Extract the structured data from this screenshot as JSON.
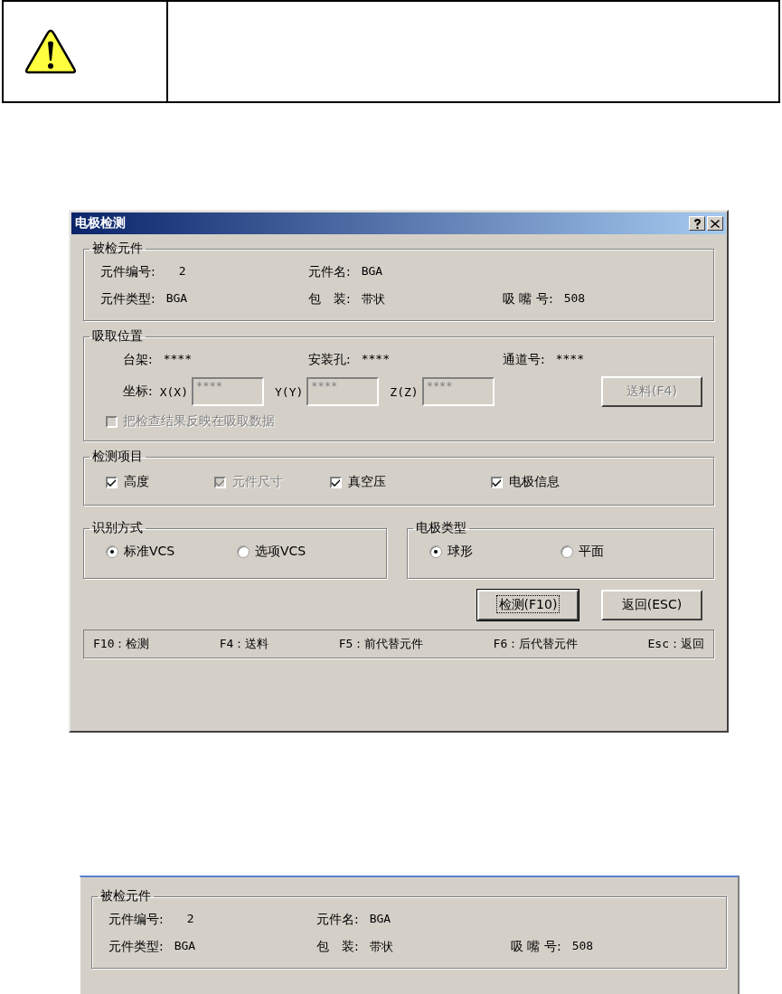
{
  "dialog": {
    "title": "电极检测",
    "part_group": {
      "title": "被检元件",
      "rows": [
        [
          {
            "label": "元件编号:",
            "value": "2"
          },
          {
            "label": "元件名:",
            "value": "BGA"
          }
        ],
        [
          {
            "label": "元件类型:",
            "value": "BGA"
          },
          {
            "label": "包　装:",
            "value": "带状"
          },
          {
            "label": "吸 嘴 号:",
            "value": "508"
          }
        ]
      ]
    },
    "pickup_group": {
      "title": "吸取位置",
      "info": [
        {
          "label": "台架:",
          "value": "****"
        },
        {
          "label": "安装孔:",
          "value": "****"
        },
        {
          "label": "通道号:",
          "value": "****"
        }
      ],
      "coord_label": "坐标:",
      "coords": [
        {
          "label": "X(X)",
          "value": "****",
          "disabled": true
        },
        {
          "label": "Y(Y)",
          "value": "****",
          "disabled": true
        },
        {
          "label": "Z(Z)",
          "value": "****",
          "disabled": true
        }
      ],
      "feed_button": {
        "label": "送料(F4)",
        "disabled": true
      },
      "reflect": {
        "label": "把检查结果反映在吸取数据",
        "checked": false,
        "disabled": true
      }
    },
    "check_group": {
      "title": "检测项目",
      "items": [
        {
          "label": "高度",
          "checked": true,
          "disabled": false
        },
        {
          "label": "元件尺寸",
          "checked": true,
          "disabled": true
        },
        {
          "label": "真空压",
          "checked": true,
          "disabled": false
        },
        {
          "label": "电极信息",
          "checked": true,
          "disabled": false
        }
      ]
    },
    "recognition_group": {
      "title": "识别方式",
      "options": [
        {
          "label": "标准VCS",
          "selected": true
        },
        {
          "label": "选项VCS",
          "selected": false
        }
      ]
    },
    "electrode_group": {
      "title": "电极类型",
      "options": [
        {
          "label": "球形",
          "selected": true
        },
        {
          "label": "平面",
          "selected": false
        }
      ]
    },
    "buttons": [
      {
        "label": "检测(F10)",
        "default": true
      },
      {
        "label": "返回(ESC)",
        "default": false
      }
    ],
    "status_bar": [
      "F10：检测",
      "F4：送料",
      "F5：前代替元件",
      "F6：后代替元件",
      "Esc：返回"
    ]
  },
  "detail": {
    "title": "被检元件",
    "rows": [
      [
        {
          "label": "元件编号:",
          "value": "2"
        },
        {
          "label": "元件名:",
          "value": "BGA"
        }
      ],
      [
        {
          "label": "元件类型:",
          "value": "BGA"
        },
        {
          "label": "包　装:",
          "value": "带状"
        },
        {
          "label": "吸 嘴 号:",
          "value": "508"
        }
      ]
    ]
  }
}
